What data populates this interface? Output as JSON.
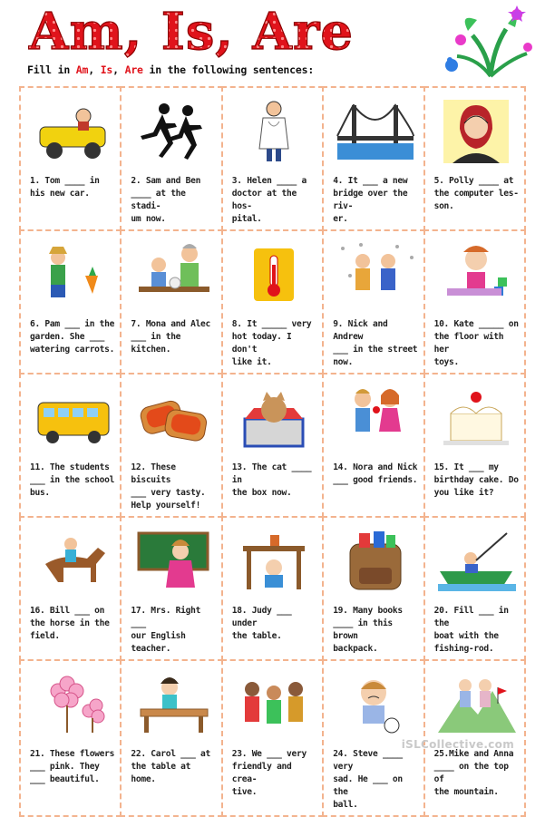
{
  "title": "Am, Is, Are",
  "instruction": {
    "prefix": "Fill in ",
    "w1": "Am",
    "sep1": ", ",
    "w2": "Is",
    "sep2": ", ",
    "w3": "Are",
    "suffix": " in the following sentences:"
  },
  "colors": {
    "title_red": "#e0131b",
    "border_dashed": "#f3b38e",
    "keyword_red": "#e0131b"
  },
  "items": [
    {
      "text": "1. Tom ____ in\nhis new car.",
      "icon": "car-driver-icon"
    },
    {
      "text": "2. Sam and Ben\n____ at the stadi-\num now.",
      "icon": "runners-icon"
    },
    {
      "text": "3. Helen ____ a\ndoctor at the hos-\npital.",
      "icon": "doctor-icon"
    },
    {
      "text": "4. It ___ a new\nbridge over the riv-\ner.",
      "icon": "bridge-icon"
    },
    {
      "text": "5. Polly ____ at\nthe computer les-\nson.",
      "icon": "headset-woman-icon"
    },
    {
      "text": "6. Pam ___ in the\ngarden. She ___\nwatering carrots.",
      "icon": "gardener-icon"
    },
    {
      "text": "7. Mona and Alec\n___ in the kitchen.",
      "icon": "kitchen-icon"
    },
    {
      "text": "8. It _____ very\nhot today. I don't\nlike it.",
      "icon": "thermometer-icon"
    },
    {
      "text": "9. Nick and Andrew\n___ in the street\nnow.",
      "icon": "snow-kids-icon"
    },
    {
      "text": "10. Kate _____ on\nthe floor with her\ntoys.",
      "icon": "girl-toys-icon"
    },
    {
      "text": "11. The students\n___ in the school\nbus.",
      "icon": "school-bus-icon"
    },
    {
      "text": "12. These biscuits\n___ very tasty.\nHelp yourself!",
      "icon": "biscuits-icon"
    },
    {
      "text": "13. The cat ____ in\nthe box now.",
      "icon": "cat-box-icon"
    },
    {
      "text": "14. Nora and Nick\n___ good friends.",
      "icon": "friends-icon"
    },
    {
      "text": "15. It ___ my\nbirthday cake. Do\nyou like it?",
      "icon": "cake-icon"
    },
    {
      "text": "16. Bill ___ on\nthe horse in the\nfield.",
      "icon": "horse-rider-icon"
    },
    {
      "text": "17. Mrs. Right ___\nour English teacher.",
      "icon": "teacher-icon"
    },
    {
      "text": "18. Judy ___ under\nthe table.",
      "icon": "under-table-icon"
    },
    {
      "text": "19. Many books\n____ in this brown\nbackpack.",
      "icon": "backpack-icon"
    },
    {
      "text": "20. Fill ___ in the\nboat with the\nfishing-rod.",
      "icon": "fishing-boat-icon"
    },
    {
      "text": "21. These flowers\n___ pink. They\n___ beautiful.",
      "icon": "pink-flowers-icon"
    },
    {
      "text": "22. Carol ___ at\nthe table at home.",
      "icon": "girl-desk-icon"
    },
    {
      "text": "23. We ___ very\nfriendly and crea-\ntive.",
      "icon": "family-icon"
    },
    {
      "text": "24. Steve ____ very\nsad. He ___ on the\nball.",
      "icon": "sad-boy-icon"
    },
    {
      "text": "25.Mike and Anna\n____ on the top of\nthe mountain.",
      "icon": "mountain-climbers-icon"
    }
  ],
  "footer": "iSLCollective.com"
}
